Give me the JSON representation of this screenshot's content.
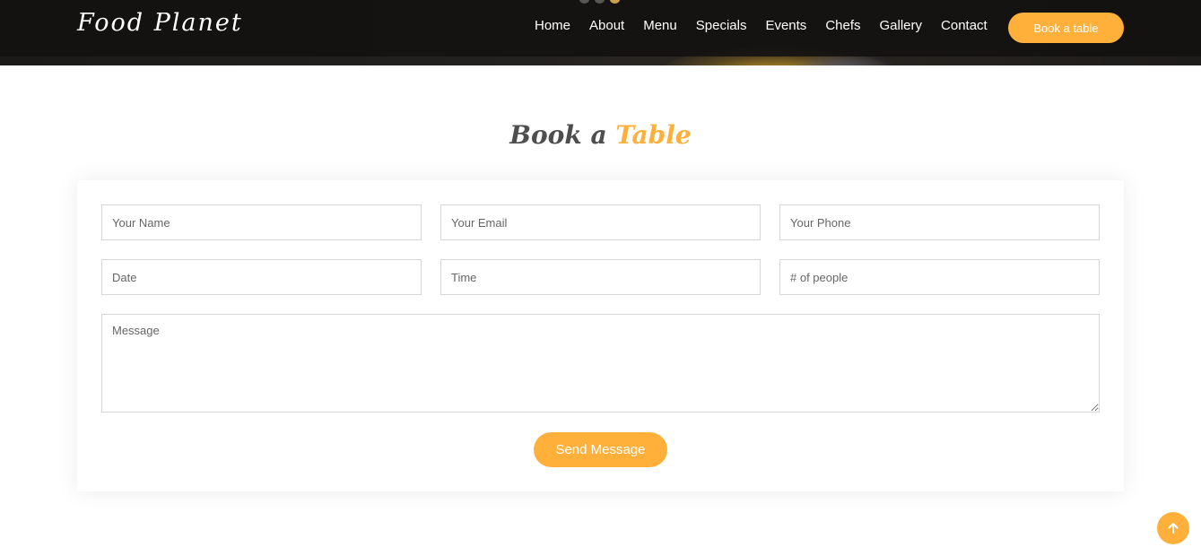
{
  "header": {
    "logo": "Food Planet",
    "nav": [
      "Home",
      "About",
      "Menu",
      "Specials",
      "Events",
      "Chefs",
      "Gallery",
      "Contact"
    ],
    "book_button": "Book a table"
  },
  "section": {
    "title_main": "Book a",
    "title_accent": "Table"
  },
  "form": {
    "name_placeholder": "Your Name",
    "email_placeholder": "Your Email",
    "phone_placeholder": "Your Phone",
    "date_placeholder": "Date",
    "time_placeholder": "Time",
    "people_placeholder": "# of people",
    "message_placeholder": "Message",
    "send_button": "Send Message"
  },
  "colors": {
    "accent": "#ffb03b",
    "header_bg": "#121110",
    "title_text": "#4e4e4e"
  },
  "icons": {
    "back_to_top": "arrow-up-icon"
  }
}
